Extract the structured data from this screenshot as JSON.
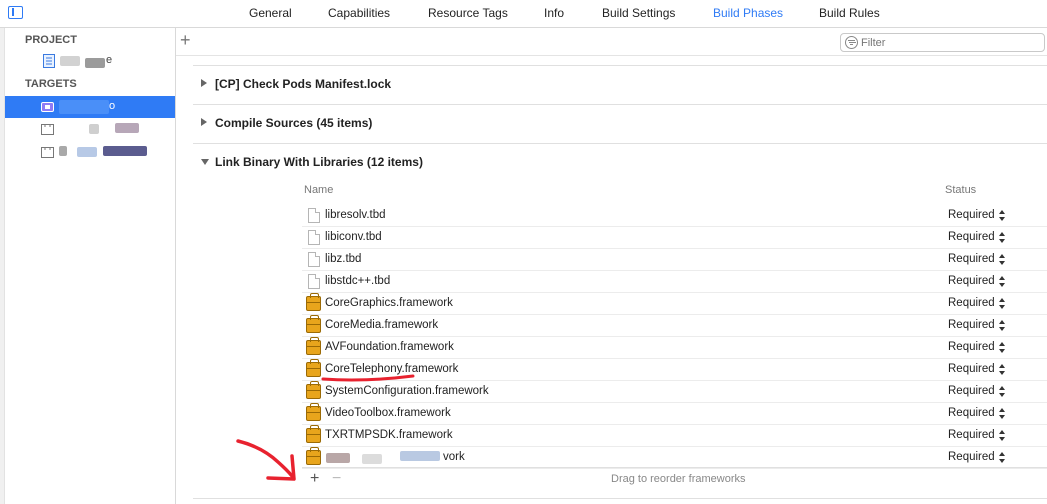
{
  "tabs": [
    {
      "label": "General",
      "active": false
    },
    {
      "label": "Capabilities",
      "active": false
    },
    {
      "label": "Resource Tags",
      "active": false
    },
    {
      "label": "Info",
      "active": false
    },
    {
      "label": "Build Settings",
      "active": false
    },
    {
      "label": "Build Phases",
      "active": true
    },
    {
      "label": "Build Rules",
      "active": false
    }
  ],
  "navigator": {
    "project_header": "PROJECT",
    "targets_header": "TARGETS",
    "project_item_suffix": "e",
    "target_selected_suffix": "o"
  },
  "toolbar": {
    "add_label": "+",
    "filter_placeholder": "Filter"
  },
  "phases": [
    {
      "title": "[CP] Check Pods Manifest.lock",
      "expanded": false
    },
    {
      "title": "Compile Sources (45 items)",
      "expanded": false
    },
    {
      "title": "Link Binary With Libraries (12 items)",
      "expanded": true
    }
  ],
  "library_table": {
    "columns": [
      "Name",
      "Status"
    ],
    "rows": [
      {
        "name": "libresolv.tbd",
        "icon": "file-icon",
        "status": "Required"
      },
      {
        "name": "libiconv.tbd",
        "icon": "file-icon",
        "status": "Required"
      },
      {
        "name": "libz.tbd",
        "icon": "file-icon",
        "status": "Required"
      },
      {
        "name": "libstdc++.tbd",
        "icon": "file-icon",
        "status": "Required"
      },
      {
        "name": "CoreGraphics.framework",
        "icon": "framework-icon",
        "status": "Required"
      },
      {
        "name": "CoreMedia.framework",
        "icon": "framework-icon",
        "status": "Required"
      },
      {
        "name": "AVFoundation.framework",
        "icon": "framework-icon",
        "status": "Required"
      },
      {
        "name": "CoreTelephony.framework",
        "icon": "framework-icon",
        "status": "Required"
      },
      {
        "name": "SystemConfiguration.framework",
        "icon": "framework-icon",
        "status": "Required"
      },
      {
        "name": "VideoToolbox.framework",
        "icon": "framework-icon",
        "status": "Required"
      },
      {
        "name": "TXRTMPSDK.framework",
        "icon": "framework-icon",
        "status": "Required"
      },
      {
        "name": "vork",
        "icon": "framework-icon",
        "status": "Required"
      }
    ],
    "footer": {
      "add_label": "+",
      "remove_label": "−",
      "hint": "Drag to reorder frameworks"
    }
  },
  "colors": {
    "accent": "#2f7bf5",
    "annotation_red": "#e8222f"
  }
}
